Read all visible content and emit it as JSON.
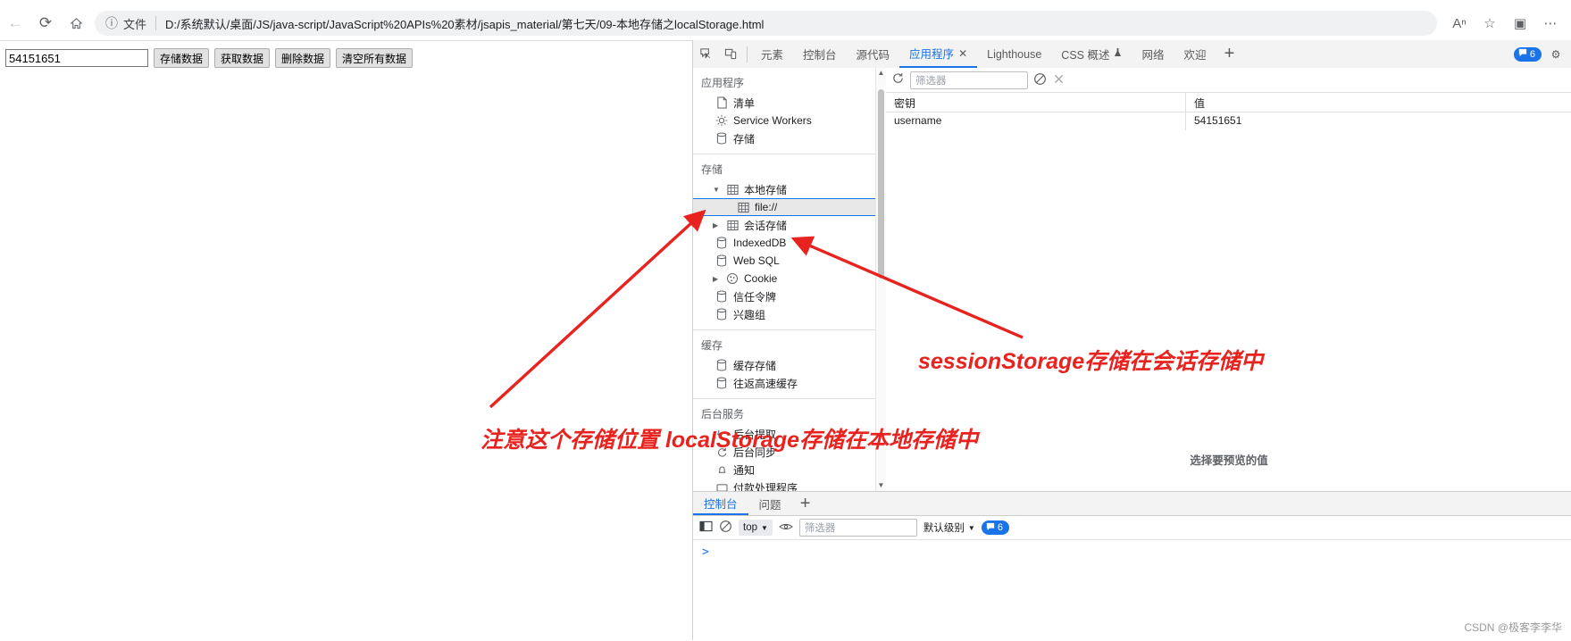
{
  "browser": {
    "nav": {
      "back_icon": "arrow-left-icon",
      "reload_icon": "reload-icon",
      "home_icon": "home-icon",
      "read_aloud_icon": "read-aloud-icon",
      "favorite_icon": "star-icon",
      "collections_icon": "collections-icon",
      "settings_icon": "ellipsis-icon"
    },
    "omnibox": {
      "info_icon": "info-circle-icon",
      "scheme_label": "文件",
      "url": "D:/系统默认/桌面/JS/java-script/JavaScript%20APIs%20素材/jsapis_material/第七天/09-本地存储之localStorage.html"
    }
  },
  "page": {
    "input_value": "54151651",
    "input_placeholder": "",
    "buttons": [
      {
        "label": "存储数据",
        "name": "save-data-button"
      },
      {
        "label": "获取数据",
        "name": "get-data-button"
      },
      {
        "label": "删除数据",
        "name": "delete-data-button"
      },
      {
        "label": "清空所有数据",
        "name": "clear-all-data-button"
      }
    ]
  },
  "devtools": {
    "toolbar": {
      "inspect_icon": "inspect-element-icon",
      "device_icon": "device-toolbar-icon",
      "error_badge_count": "6",
      "error_badge_icon": "message-bubble-icon",
      "settings_icon": "gear-icon",
      "add_tab_label": "+"
    },
    "tabs": [
      {
        "label": "元素",
        "active": false,
        "closable": false
      },
      {
        "label": "控制台",
        "active": false,
        "closable": false
      },
      {
        "label": "源代码",
        "active": false,
        "closable": false
      },
      {
        "label": "应用程序",
        "active": true,
        "closable": true
      },
      {
        "label": "Lighthouse",
        "active": false,
        "closable": false
      },
      {
        "label": "CSS 概述",
        "active": false,
        "closable": false,
        "badge_icon": "flask-icon"
      },
      {
        "label": "网络",
        "active": false,
        "closable": false
      },
      {
        "label": "欢迎",
        "active": false,
        "closable": false
      }
    ],
    "sidebar": {
      "sections": [
        {
          "title": "应用程序",
          "items": [
            {
              "label": "清单",
              "icon": "document-icon",
              "indent": 1,
              "caret": "",
              "selected": false
            },
            {
              "label": "Service Workers",
              "icon": "gear-icon",
              "indent": 1,
              "caret": "",
              "selected": false
            },
            {
              "label": "存储",
              "icon": "database-icon",
              "indent": 1,
              "caret": "",
              "selected": false
            }
          ]
        },
        {
          "title": "存储",
          "items": [
            {
              "label": "本地存储",
              "icon": "table-icon",
              "indent": 1,
              "caret": "▼",
              "selected": false
            },
            {
              "label": "file://",
              "icon": "table-icon",
              "indent": 2,
              "caret": "",
              "selected": true
            },
            {
              "label": "会话存储",
              "icon": "table-icon",
              "indent": 1,
              "caret": "▶",
              "selected": false
            },
            {
              "label": "IndexedDB",
              "icon": "database-icon",
              "indent": 1,
              "caret": "",
              "selected": false
            },
            {
              "label": "Web SQL",
              "icon": "database-icon",
              "indent": 1,
              "caret": "",
              "selected": false
            },
            {
              "label": "Cookie",
              "icon": "cookie-icon",
              "indent": 1,
              "caret": "▶",
              "selected": false
            },
            {
              "label": "信任令牌",
              "icon": "database-icon",
              "indent": 1,
              "caret": "",
              "selected": false
            },
            {
              "label": "兴趣组",
              "icon": "database-icon",
              "indent": 1,
              "caret": "",
              "selected": false
            }
          ]
        },
        {
          "title": "缓存",
          "items": [
            {
              "label": "缓存存储",
              "icon": "database-icon",
              "indent": 1,
              "caret": "",
              "selected": false
            },
            {
              "label": "往返高速缓存",
              "icon": "database-icon",
              "indent": 1,
              "caret": "",
              "selected": false
            }
          ]
        },
        {
          "title": "后台服务",
          "items": [
            {
              "label": "后台提取",
              "icon": "download-arrow-icon",
              "indent": 1,
              "caret": "",
              "selected": false
            },
            {
              "label": "后台同步",
              "icon": "sync-icon",
              "indent": 1,
              "caret": "",
              "selected": false
            },
            {
              "label": "通知",
              "icon": "bell-icon",
              "indent": 1,
              "caret": "",
              "selected": false
            },
            {
              "label": "付款处理程序",
              "icon": "payment-icon",
              "indent": 1,
              "caret": "",
              "selected": false
            }
          ]
        }
      ]
    },
    "storage_panel": {
      "toolbar": {
        "refresh_icon": "refresh-icon",
        "filter_placeholder": "筛选器",
        "filter_value": "",
        "clear_icon": "clear-all-icon",
        "delete_icon": "delete-selected-icon"
      },
      "columns": [
        "密钥",
        "值"
      ],
      "rows": [
        {
          "key": "username",
          "value": "54151651"
        }
      ],
      "preview_note": "选择要预览的值"
    },
    "drawer": {
      "tabs": [
        {
          "label": "控制台",
          "active": true
        },
        {
          "label": "问题",
          "active": false
        }
      ],
      "add_tab_label": "+",
      "toolbar": {
        "sidebar_icon": "console-sidebar-icon",
        "clear_icon": "clear-console-icon",
        "context_value": "top",
        "context_caret": "▼",
        "eye_icon": "live-expression-icon",
        "filter_placeholder": "筛选器",
        "filter_value": "",
        "level_label": "默认级别",
        "level_caret": "▼",
        "error_badge_count": "6",
        "error_badge_icon": "message-bubble-icon"
      },
      "prompt_symbol": ">"
    }
  },
  "annotations": {
    "local": "注意这个存储位置 localStorage存储在本地存储中",
    "session": "sessionStorage存储在会话存储中",
    "color": "#e8231f"
  },
  "watermark": "CSDN @极客李李华"
}
